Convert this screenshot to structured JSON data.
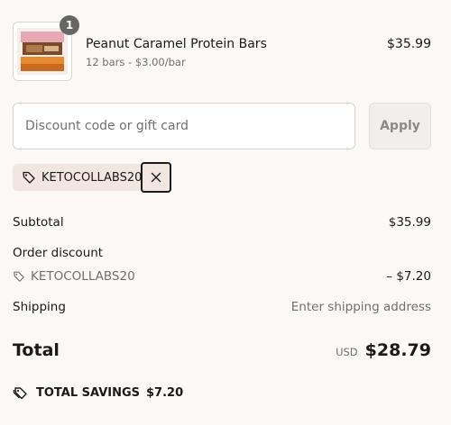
{
  "cart": {
    "quantity": "1",
    "product_name": "Peanut Caramel Protein Bars",
    "variant": "12 bars - $3.00/bar",
    "price": "$35.99"
  },
  "discount": {
    "placeholder": "Discount code or gift card",
    "apply_label": "Apply",
    "applied_code": "KETOCOLLABS20"
  },
  "summary": {
    "subtotal_label": "Subtotal",
    "subtotal_value": "$35.99",
    "order_discount_label": "Order discount",
    "discount_code": "KETOCOLLABS20",
    "discount_value": "– $7.20",
    "shipping_label": "Shipping",
    "shipping_value": "Enter shipping address",
    "total_label": "Total",
    "currency": "USD",
    "total_value": "$28.79",
    "savings_label": "TOTAL SAVINGS",
    "savings_value": "$7.20"
  },
  "icons": {
    "tag": "tag-icon",
    "remove": "close-icon",
    "savings": "savings-tag-icon"
  },
  "colors": {
    "background": "#fcf8f5",
    "chip": "#f1e7e0",
    "badge": "#666666"
  }
}
